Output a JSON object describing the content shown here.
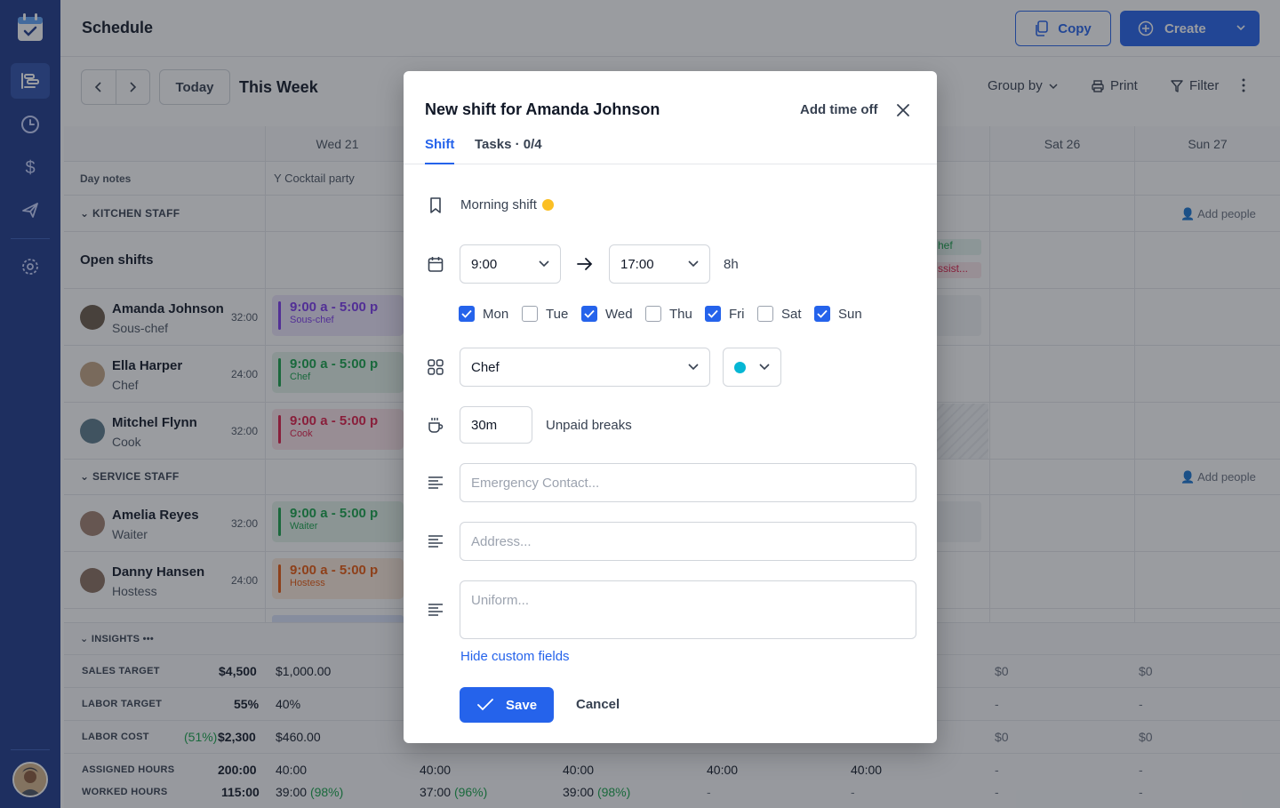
{
  "app": {
    "title": "Schedule"
  },
  "header": {
    "copy_label": "Copy",
    "create_label": "Create"
  },
  "toolbar": {
    "today_label": "Today",
    "week_label": "This Week",
    "group_by_label": "Group by",
    "print_label": "Print",
    "filter_label": "Filter"
  },
  "schedule": {
    "days": [
      "Wed 21",
      "Sat 26",
      "Sun 27"
    ],
    "day_notes_label": "Day notes",
    "day_note_wed": "Cocktail party",
    "kitchen_label": "KITCHEN STAFF",
    "service_label": "SERVICE STAFF",
    "add_people_label": "Add people",
    "open_shifts_label": "Open shifts",
    "open_shift_chip_1": "hef",
    "open_shift_chip_2": "ssist...",
    "people": [
      {
        "name": "Amanda Johnson",
        "role": "Sous-chef",
        "hours": "32:00",
        "shift_time": "9:00 a - 5:00 p",
        "shift_role": "Sous-chef"
      },
      {
        "name": "Ella Harper",
        "role": "Chef",
        "hours": "24:00",
        "shift_time": "9:00 a - 5:00 p",
        "shift_role": "Chef"
      },
      {
        "name": "Mitchel Flynn",
        "role": "Cook",
        "hours": "32:00",
        "shift_time": "9:00 a - 5:00 p",
        "shift_role": "Cook"
      },
      {
        "name": "Amelia Reyes",
        "role": "Waiter",
        "hours": "32:00",
        "shift_time": "9:00 a - 5:00 p",
        "shift_role": "Waiter"
      },
      {
        "name": "Danny Hansen",
        "role": "Hostess",
        "hours": "24:00",
        "shift_time": "9:00 a - 5:00 p",
        "shift_role": "Hostess"
      }
    ]
  },
  "insights": {
    "label": "INSIGHTS",
    "sales_target": {
      "label": "SALES TARGET",
      "total": "$4,500",
      "wed": "$1,000.00",
      "sat": "$0",
      "sun": "$0"
    },
    "labor_target": {
      "label": "LABOR TARGET",
      "total": "55%",
      "wed": "40%",
      "sat": "-",
      "sun": "-"
    },
    "labor_cost": {
      "label": "LABOR COST",
      "pct": "(51%)",
      "total": "$2,300",
      "wed": "$460.00",
      "sat": "$0",
      "sun": "$0"
    },
    "assigned_hours": {
      "label": "ASSIGNED HOURS",
      "total": "200:00",
      "cols": [
        "40:00",
        "40:00",
        "40:00",
        "40:00",
        "40:00",
        "-",
        "-"
      ]
    },
    "worked_hours": {
      "label": "WORKED HOURS",
      "total": "115:00",
      "c1": "39:00",
      "p1": "(98%)",
      "c2": "37:00",
      "p2": "(96%)",
      "c3": "39:00",
      "p3": "(98%)",
      "rest": [
        "-",
        "-",
        "-",
        "-"
      ]
    }
  },
  "modal": {
    "title": "New shift for Amanda Johnson",
    "add_time_off": "Add time off",
    "tabs": [
      "Shift",
      "Tasks · 0/4"
    ],
    "shift_name": "Morning shift",
    "start_time": "9:00",
    "end_time": "17:00",
    "duration": "8h",
    "days": [
      {
        "label": "Mon",
        "checked": true
      },
      {
        "label": "Tue",
        "checked": false
      },
      {
        "label": "Wed",
        "checked": true
      },
      {
        "label": "Thu",
        "checked": false
      },
      {
        "label": "Fri",
        "checked": true
      },
      {
        "label": "Sat",
        "checked": false
      },
      {
        "label": "Sun",
        "checked": true
      }
    ],
    "position": "Chef",
    "color": "#06b6d4",
    "break_value": "30m",
    "break_label": "Unpaid breaks",
    "emergency_placeholder": "Emergency Contact...",
    "address_placeholder": "Address...",
    "uniform_placeholder": "Uniform...",
    "hide_custom_fields": "Hide custom fields",
    "save_label": "Save",
    "cancel_label": "Cancel"
  },
  "colors": {
    "primary": "#2563eb",
    "sidebar": "#1e3a8a",
    "purple": "#7c3aed",
    "green": "#16a34a",
    "red": "#e11d48",
    "orange": "#ea580c"
  }
}
